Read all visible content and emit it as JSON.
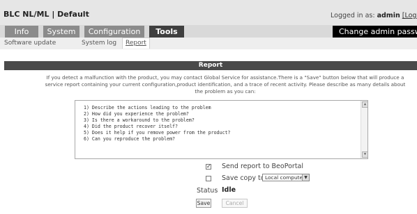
{
  "header": {
    "title": "BLC NL/ML | Default",
    "logged_in_prefix": "Logged in as:",
    "user": "admin",
    "logout_label": "[Log ou"
  },
  "tabs": [
    {
      "label": "Info"
    },
    {
      "label": "System"
    },
    {
      "label": "Configuration"
    },
    {
      "label": "Tools",
      "active": true
    }
  ],
  "admin_password_button": "Change admin password",
  "subnav": [
    {
      "label": "Software update"
    },
    {
      "label": "System log"
    },
    {
      "label": "Report",
      "active": true
    }
  ],
  "report": {
    "heading": "Report",
    "intro": "If you detect a malfunction with the product, you may contact Global Service for assistance.There is a \"Save\" button below that will produce a service report containing your current configuration,product identification, and a trace of recent activity. Please describe as many details about the problem as you can:",
    "textarea_lines": [
      "1) Describe the actions leading to the problem",
      "2) How did you experience the problem?",
      "3) Is there a workaround to the problem?",
      "4) Did the product recover itself?",
      "5) Does it help if you remove power from the product?",
      "6) Can you reproduce the problem?"
    ],
    "send_label": "Send report to BeoPortal",
    "send_checked": true,
    "save_copy_label": "Save copy to",
    "save_copy_checked": false,
    "save_copy_option": "Local computer",
    "status_label": "Status",
    "status_value": "Idle",
    "save_button": "Save",
    "cancel_button": "Cancel"
  }
}
